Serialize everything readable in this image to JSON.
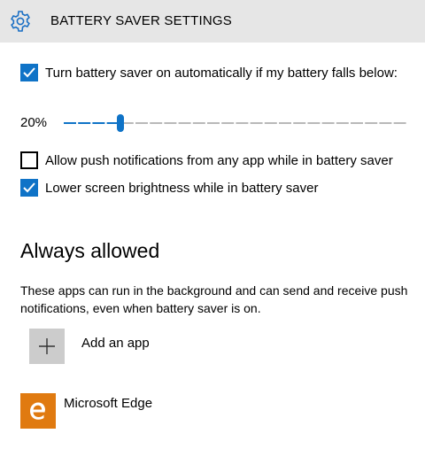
{
  "header": {
    "title": "BATTERY SAVER SETTINGS",
    "icon": "gear-icon"
  },
  "options": {
    "auto_on": {
      "label": "Turn battery saver on automatically if my battery falls below:",
      "checked": true
    },
    "threshold": {
      "value_label": "20%",
      "value": 20
    },
    "push_notifications": {
      "label": "Allow push notifications from any app while in battery saver",
      "checked": false
    },
    "lower_brightness": {
      "label": "Lower screen brightness while in battery saver",
      "checked": true
    }
  },
  "always_allowed": {
    "title": "Always allowed",
    "description": "These apps can run in the background and can send and receive push notifications, even when battery saver is on.",
    "add_label": "Add an app",
    "apps": [
      {
        "name": "Microsoft Edge",
        "icon": "edge-icon",
        "color": "#e07a10"
      }
    ]
  },
  "colors": {
    "accent": "#0f73c7",
    "header_bg": "#e6e6e6"
  }
}
